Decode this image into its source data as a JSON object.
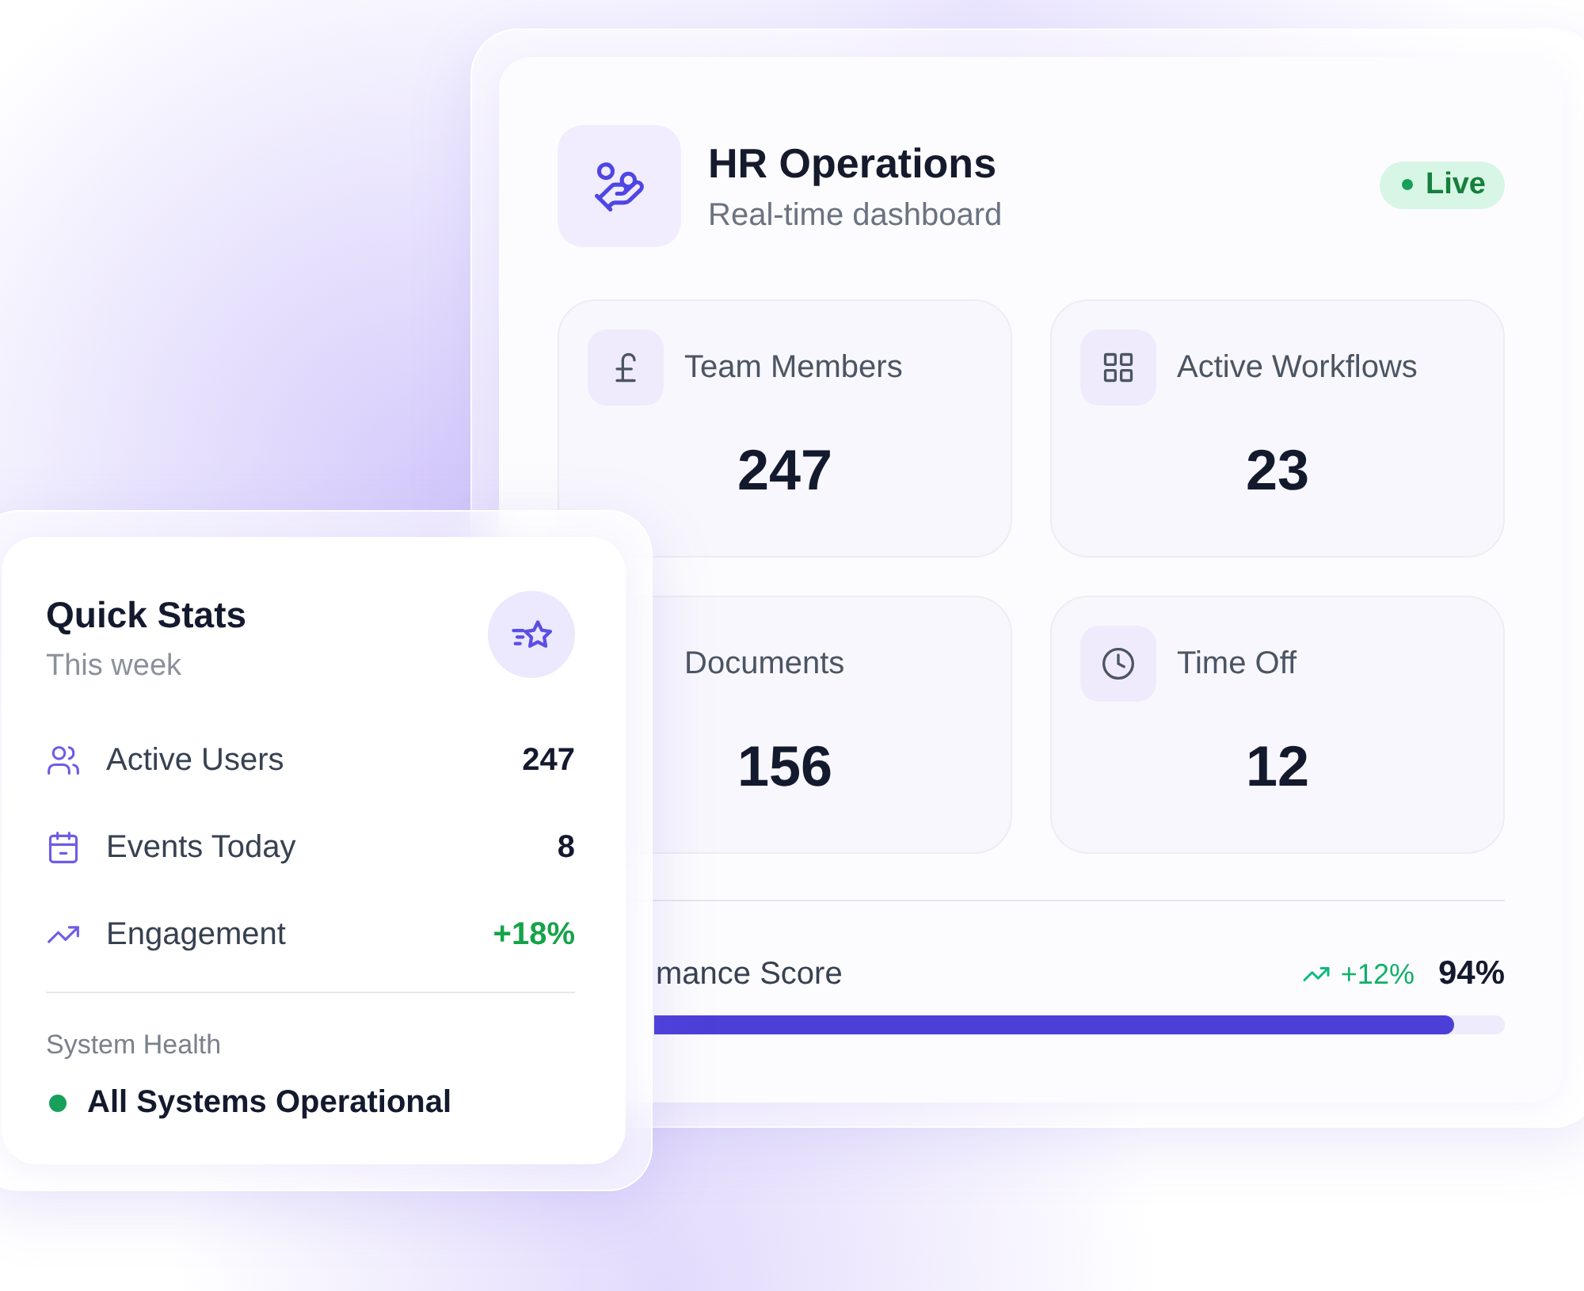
{
  "header": {
    "title": "HR Operations",
    "subtitle": "Real-time dashboard",
    "badge": {
      "label": "Live"
    }
  },
  "stat_cards": [
    {
      "label": "Team Members",
      "value": "247"
    },
    {
      "label": "Active Workflows",
      "value": "23"
    },
    {
      "label": "Documents",
      "value": "156"
    },
    {
      "label": "Time Off",
      "value": "12"
    }
  ],
  "performance": {
    "label": "mance Score",
    "change": "+12%",
    "value": "94%",
    "level": 0.94
  },
  "quick_stats": {
    "title": "Quick Stats",
    "subtitle": "This week",
    "rows": [
      {
        "label": "Active Users",
        "value": "247",
        "positive": false
      },
      {
        "label": "Events Today",
        "value": "8",
        "positive": false
      },
      {
        "label": "Engagement",
        "value": "+18%",
        "positive": true
      }
    ],
    "system_health": {
      "label": "System Health",
      "status": "All Systems Operational"
    }
  }
}
